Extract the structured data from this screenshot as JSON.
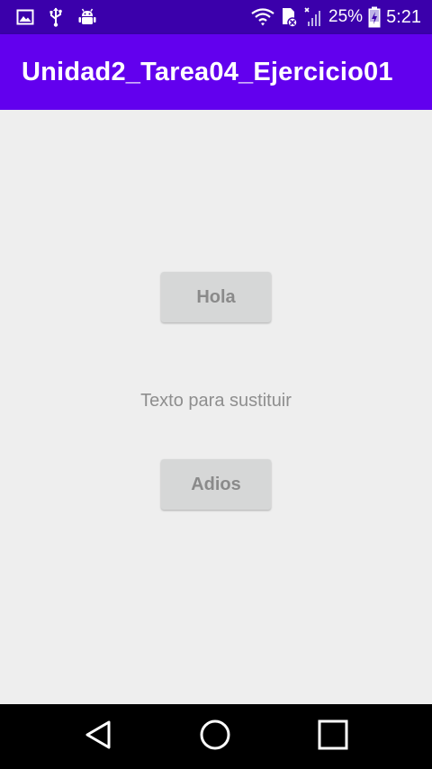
{
  "status_bar": {
    "icons_left": [
      "image-icon",
      "usb-icon",
      "android-debug-icon"
    ],
    "icons_right": [
      "wifi-icon",
      "sim-card-error-icon",
      "signal-off-icon",
      "battery-charging-icon"
    ],
    "battery_percent": "25%",
    "time": "5:21",
    "background_color": "#3b00ab"
  },
  "app_bar": {
    "title": "Unidad2_Tarea04_Ejercicio01",
    "background_color": "#6200ee"
  },
  "main": {
    "button_hola_label": "Hola",
    "text_label": "Texto para sustituir",
    "button_adios_label": "Adios",
    "background_color": "#eeeeee",
    "button_color": "#d6d7d7"
  },
  "nav_bar": {
    "icons": [
      "back-icon",
      "home-icon",
      "recents-icon"
    ],
    "background_color": "#000000"
  }
}
